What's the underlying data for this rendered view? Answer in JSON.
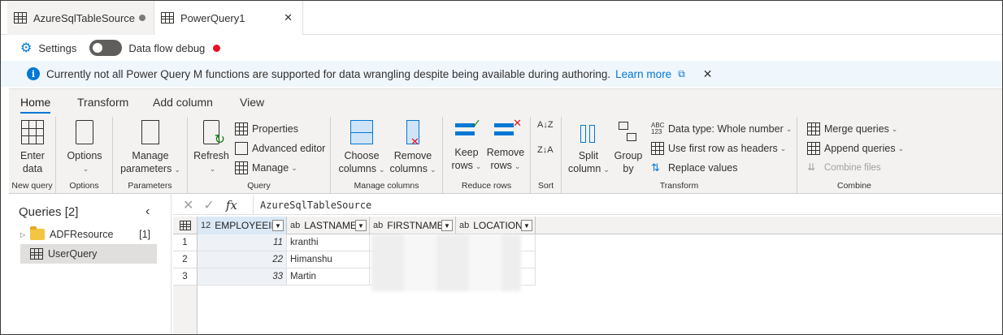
{
  "tabs": [
    {
      "label": "AzureSqlTableSource"
    },
    {
      "label": "PowerQuery1"
    }
  ],
  "settings": {
    "settings_label": "Settings",
    "debug_label": "Data flow debug",
    "debug_status_color": "#e81123"
  },
  "infobar": {
    "message": "Currently not all Power Query M functions are supported for data wrangling despite being available during authoring.",
    "link": "Learn more"
  },
  "ribbon": {
    "tabs": [
      "Home",
      "Transform",
      "Add column",
      "View"
    ],
    "active_tab": "Home",
    "groups": {
      "new_query": {
        "label": "New query",
        "enter_data_line1": "Enter",
        "enter_data_line2": "data"
      },
      "options": {
        "label": "Options",
        "options_btn": "Options"
      },
      "parameters": {
        "label": "Parameters",
        "manage_line1": "Manage",
        "manage_line2": "parameters"
      },
      "query": {
        "label": "Query",
        "refresh": "Refresh",
        "properties": "Properties",
        "advanced_editor": "Advanced editor",
        "manage": "Manage"
      },
      "manage_columns": {
        "label": "Manage columns",
        "choose_line1": "Choose",
        "choose_line2": "columns",
        "remove_line1": "Remove",
        "remove_line2": "columns"
      },
      "reduce_rows": {
        "label": "Reduce rows",
        "keep_line1": "Keep",
        "keep_line2": "rows",
        "remove_line1": "Remove",
        "remove_line2": "rows"
      },
      "sort": {
        "label": "Sort"
      },
      "transform": {
        "label": "Transform",
        "split_line1": "Split",
        "split_line2": "column",
        "group_line1": "Group",
        "group_line2": "by",
        "data_type": "Data type: Whole number",
        "first_row": "Use first row as headers",
        "replace": "Replace values"
      },
      "combine": {
        "label": "Combine",
        "merge": "Merge queries",
        "append": "Append queries",
        "combine_files": "Combine files"
      }
    }
  },
  "queries": {
    "title": "Queries [2]",
    "items": [
      {
        "label": "ADFResource",
        "count": "[1]"
      },
      {
        "label": "UserQuery"
      }
    ]
  },
  "formula": {
    "value": "AzureSqlTableSource"
  },
  "grid": {
    "columns": [
      {
        "type": "12",
        "name": "EMPLOYEEID"
      },
      {
        "type": "ab",
        "name": "LASTNAME"
      },
      {
        "type": "ab",
        "name": "FIRSTNAME"
      },
      {
        "type": "ab",
        "name": "LOCATION"
      }
    ],
    "rows": [
      {
        "num": "1",
        "id": "11",
        "last": "kranthi"
      },
      {
        "num": "2",
        "id": "22",
        "last": "Himanshu"
      },
      {
        "num": "3",
        "id": "33",
        "last": "Martin"
      }
    ]
  }
}
